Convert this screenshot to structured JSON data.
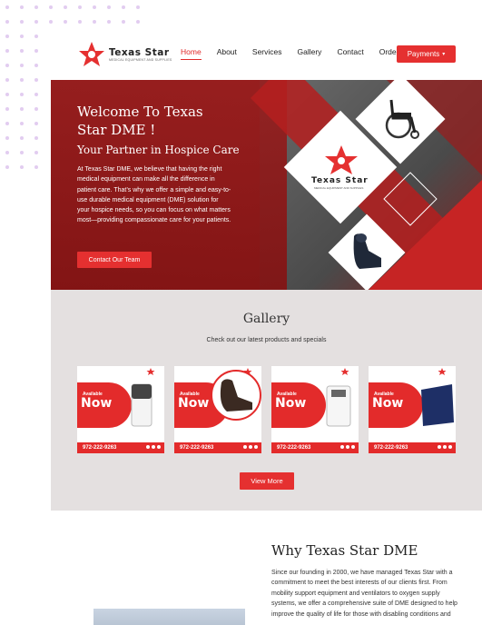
{
  "brand": {
    "name": "Texas Star",
    "tagline": "MEDICAL EQUIPMENT AND SUPPLIES",
    "accent": "#e53030"
  },
  "nav": {
    "items": [
      "Home",
      "About",
      "Services",
      "Gallery",
      "Contact",
      "Orders"
    ],
    "active": "Home",
    "payments_label": "Payments"
  },
  "hero": {
    "title": "Welcome To Texas Star DME !",
    "subtitle": "Your Partner in Hospice Care",
    "body": "At Texas Star DME, we believe that having the right medical equipment can make all the difference in patient care. That’s why we offer a simple and easy-to-use durable medical equipment (DME) solution for your hospice needs, so you can focus on what matters most—providing compassionate care for your patients.",
    "cta_label": "Contact Our Team",
    "logo_name": "Texas Star",
    "logo_sub": "MEDICAL EQUIPMENT AND SUPPLIES",
    "images": [
      "wheelchair-image",
      "massage-chair-image"
    ]
  },
  "gallery": {
    "title": "Gallery",
    "subtitle": "Check out our latest products and specials",
    "cards": [
      {
        "available": "Available",
        "now": "Now",
        "phone": "972-222-9263",
        "product": "oxygen-concentrator-image"
      },
      {
        "available": "Available",
        "now": "Now",
        "phone": "972-222-9263",
        "product": "massage-chair-image"
      },
      {
        "available": "Available",
        "now": "Now",
        "phone": "972-222-9263",
        "product": "oxygen-concentrator-image"
      },
      {
        "available": "Available",
        "now": "Now",
        "phone": "972-222-9263",
        "product": "mattress-image"
      }
    ],
    "view_more_label": "View More"
  },
  "why": {
    "title": "Why Texas Star DME",
    "body": "Since our founding in 2000, we have managed Texas Star with a commitment to meet the best interests of our clients first. From mobility support equipment and ventilators to oxygen supply systems, we offer a comprehensive suite of DME designed to help improve the quality of life for those with disabling conditions and"
  }
}
